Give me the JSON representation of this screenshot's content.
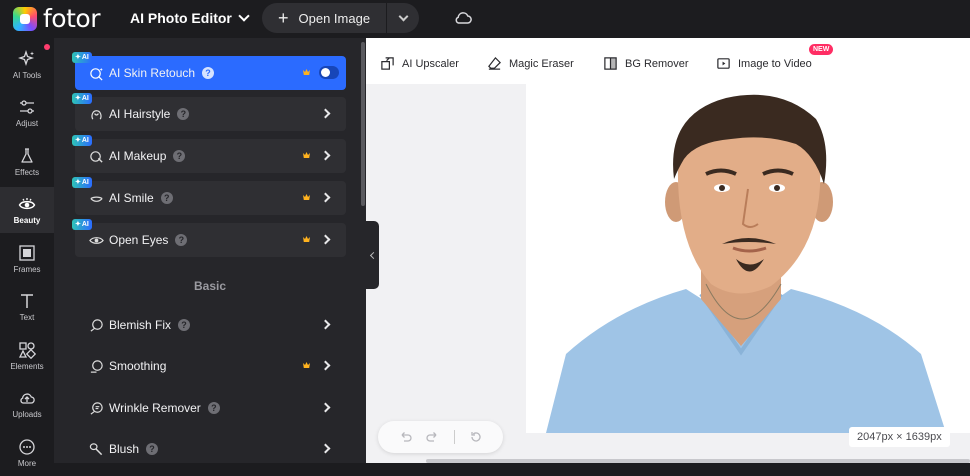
{
  "app": {
    "logo_text": "fotor",
    "editor_menu_label": "AI Photo Editor",
    "open_image_label": "Open Image",
    "icons": {
      "logo": "fotor-logo-icon",
      "cloud": "cloud-icon",
      "dropdown": "chevron-down-icon"
    }
  },
  "leftnav": {
    "items": [
      {
        "label": "AI Tools",
        "icon": "sparkle-icon"
      },
      {
        "label": "Adjust",
        "icon": "sliders-icon"
      },
      {
        "label": "Effects",
        "icon": "flask-icon"
      },
      {
        "label": "Beauty",
        "icon": "eye-icon",
        "active": true
      },
      {
        "label": "Frames",
        "icon": "frame-icon"
      },
      {
        "label": "Text",
        "icon": "text-icon"
      },
      {
        "label": "Elements",
        "icon": "shapes-icon"
      },
      {
        "label": "Uploads",
        "icon": "cloud-upload-icon"
      },
      {
        "label": "More",
        "icon": "more-icon"
      }
    ]
  },
  "panel": {
    "ai_badge": "AI",
    "help_glyph": "?",
    "ai_tools": [
      {
        "label": "AI Skin Retouch",
        "active": true,
        "pro": true,
        "toggle": true,
        "toggle_on": false
      },
      {
        "label": "AI Hairstyle",
        "pro": false
      },
      {
        "label": "AI Makeup",
        "pro": true
      },
      {
        "label": "AI Smile",
        "pro": true
      },
      {
        "label": "Open Eyes",
        "pro": true
      }
    ],
    "basic_title": "Basic",
    "basic_tools": [
      {
        "label": "Blemish Fix",
        "pro": false
      },
      {
        "label": "Smoothing",
        "pro": true
      },
      {
        "label": "Wrinkle Remover",
        "pro": false
      },
      {
        "label": "Blush",
        "pro": false
      }
    ]
  },
  "toolbar": {
    "items": [
      {
        "label": "AI Upscaler",
        "icon": "upscale-icon"
      },
      {
        "label": "Magic Eraser",
        "icon": "eraser-icon"
      },
      {
        "label": "BG Remover",
        "icon": "bg-remove-icon"
      },
      {
        "label": "Image to Video",
        "icon": "video-icon"
      }
    ],
    "new_badge": "NEW"
  },
  "canvas": {
    "image_desc": "portrait photo",
    "dimensions_label": "2047px × 1639px"
  },
  "colors": {
    "accent": "#2b6bff",
    "pro_crown": "#ffb21e",
    "new_badge": "#ff2d64"
  }
}
